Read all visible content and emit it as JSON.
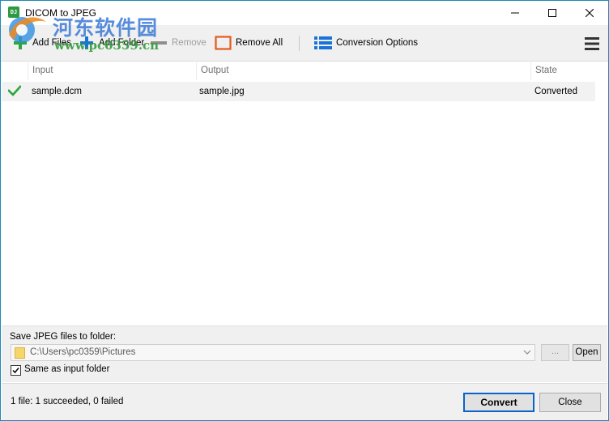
{
  "window": {
    "title": "DICOM to JPEG",
    "icon_text": "DJ",
    "controls": [
      "minimize-icon",
      "maximize-icon",
      "close-icon"
    ]
  },
  "watermark": {
    "text": "河东软件园",
    "url": "www.pc0359.cn"
  },
  "toolbar": {
    "add_files": "Add Files",
    "add_folder": "Add Folder",
    "remove": "Remove",
    "remove_all": "Remove All",
    "conversion_options": "Conversion Options",
    "menu_icon": "hamburger-menu-icon"
  },
  "list": {
    "columns": [
      "Input",
      "Output",
      "State"
    ],
    "rows": [
      {
        "status_icon": "checkmark-icon",
        "input": "sample.dcm",
        "output": "sample.jpg",
        "state": "Converted"
      }
    ]
  },
  "save": {
    "label": "Save JPEG files to folder:",
    "path": "C:\\Users\\pc0359\\Pictures",
    "browse_label": "...",
    "open_label": "Open",
    "same_as_input_label": "Same as input folder",
    "same_as_input_checked": true
  },
  "status": {
    "text": "1 file: 1 succeeded, 0 failed",
    "convert_label": "Convert",
    "close_label": "Close"
  },
  "colors": {
    "accent_blue": "#1a73d8",
    "success_green": "#2aa63a",
    "remove_all_orange": "#e35b1c",
    "default_button_border": "#0a64c8"
  }
}
